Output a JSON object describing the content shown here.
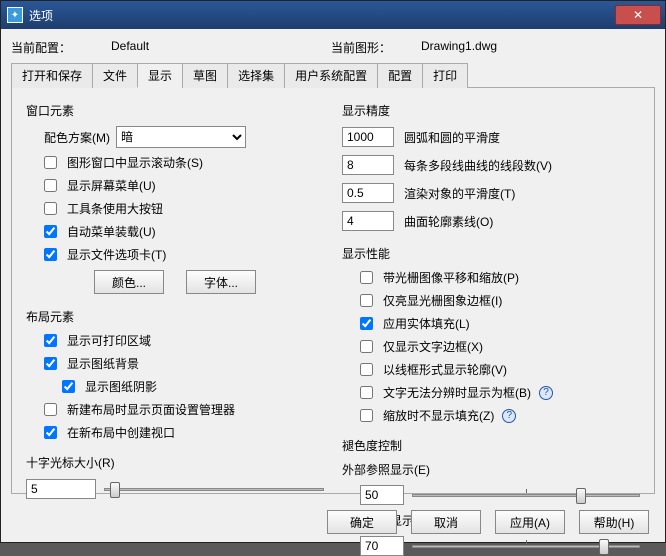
{
  "window": {
    "title": "选项"
  },
  "info": {
    "config_label": "当前配置：",
    "config_value": "Default",
    "drawing_label": "当前图形：",
    "drawing_value": "Drawing1.dwg"
  },
  "tabs": [
    "打开和保存",
    "文件",
    "显示",
    "草图",
    "选择集",
    "用户系统配置",
    "配置",
    "打印"
  ],
  "active_tab_index": 2,
  "left": {
    "window_elements": "窗口元素",
    "color_scheme_label": "配色方案(M)",
    "color_scheme_value": "暗",
    "scroll_bars": "图形窗口中显示滚动条(S)",
    "screen_menu": "显示屏幕菜单(U)",
    "large_buttons": "工具条使用大按钮",
    "auto_menu_load": "自动菜单装载(U)",
    "file_tabs": "显示文件选项卡(T)",
    "color_btn": "颜色...",
    "font_btn": "字体...",
    "layout_elements": "布局元素",
    "print_area": "显示可打印区域",
    "paper_bg": "显示图纸背景",
    "paper_shadow": "显示图纸阴影",
    "page_setup_mgr": "新建布局时显示页面设置管理器",
    "create_viewport": "在新布局中创建视口",
    "crosshair_label": "十字光标大小(R)",
    "crosshair_value": "5"
  },
  "right": {
    "display_precision": "显示精度",
    "arc_value": "1000",
    "arc_label": "圆弧和圆的平滑度",
    "seg_value": "8",
    "seg_label": "每条多段线曲线的线段数(V)",
    "render_value": "0.5",
    "render_label": "渲染对象的平滑度(T)",
    "surf_value": "4",
    "surf_label": "曲面轮廓素线(O)",
    "display_perf": "显示性能",
    "raster_pan": "带光栅图像平移和缩放(P)",
    "highlight_raster": "仅亮显光栅图象边框(I)",
    "solid_fill": "应用实体填充(L)",
    "text_frame": "仅显示文字边框(X)",
    "wireframe": "以线框形式显示轮廓(V)",
    "text_box": "文字无法分辨时显示为框(B)",
    "zoom_fill": "缩放时不显示填充(Z)",
    "fade_control": "褪色度控制",
    "xref_label": "外部参照显示(E)",
    "xref_value": "50",
    "inplace_label": "在位编辑显示(Y)",
    "inplace_value": "70"
  },
  "buttons": {
    "ok": "确定",
    "cancel": "取消",
    "apply": "应用(A)",
    "help": "帮助(H)"
  }
}
